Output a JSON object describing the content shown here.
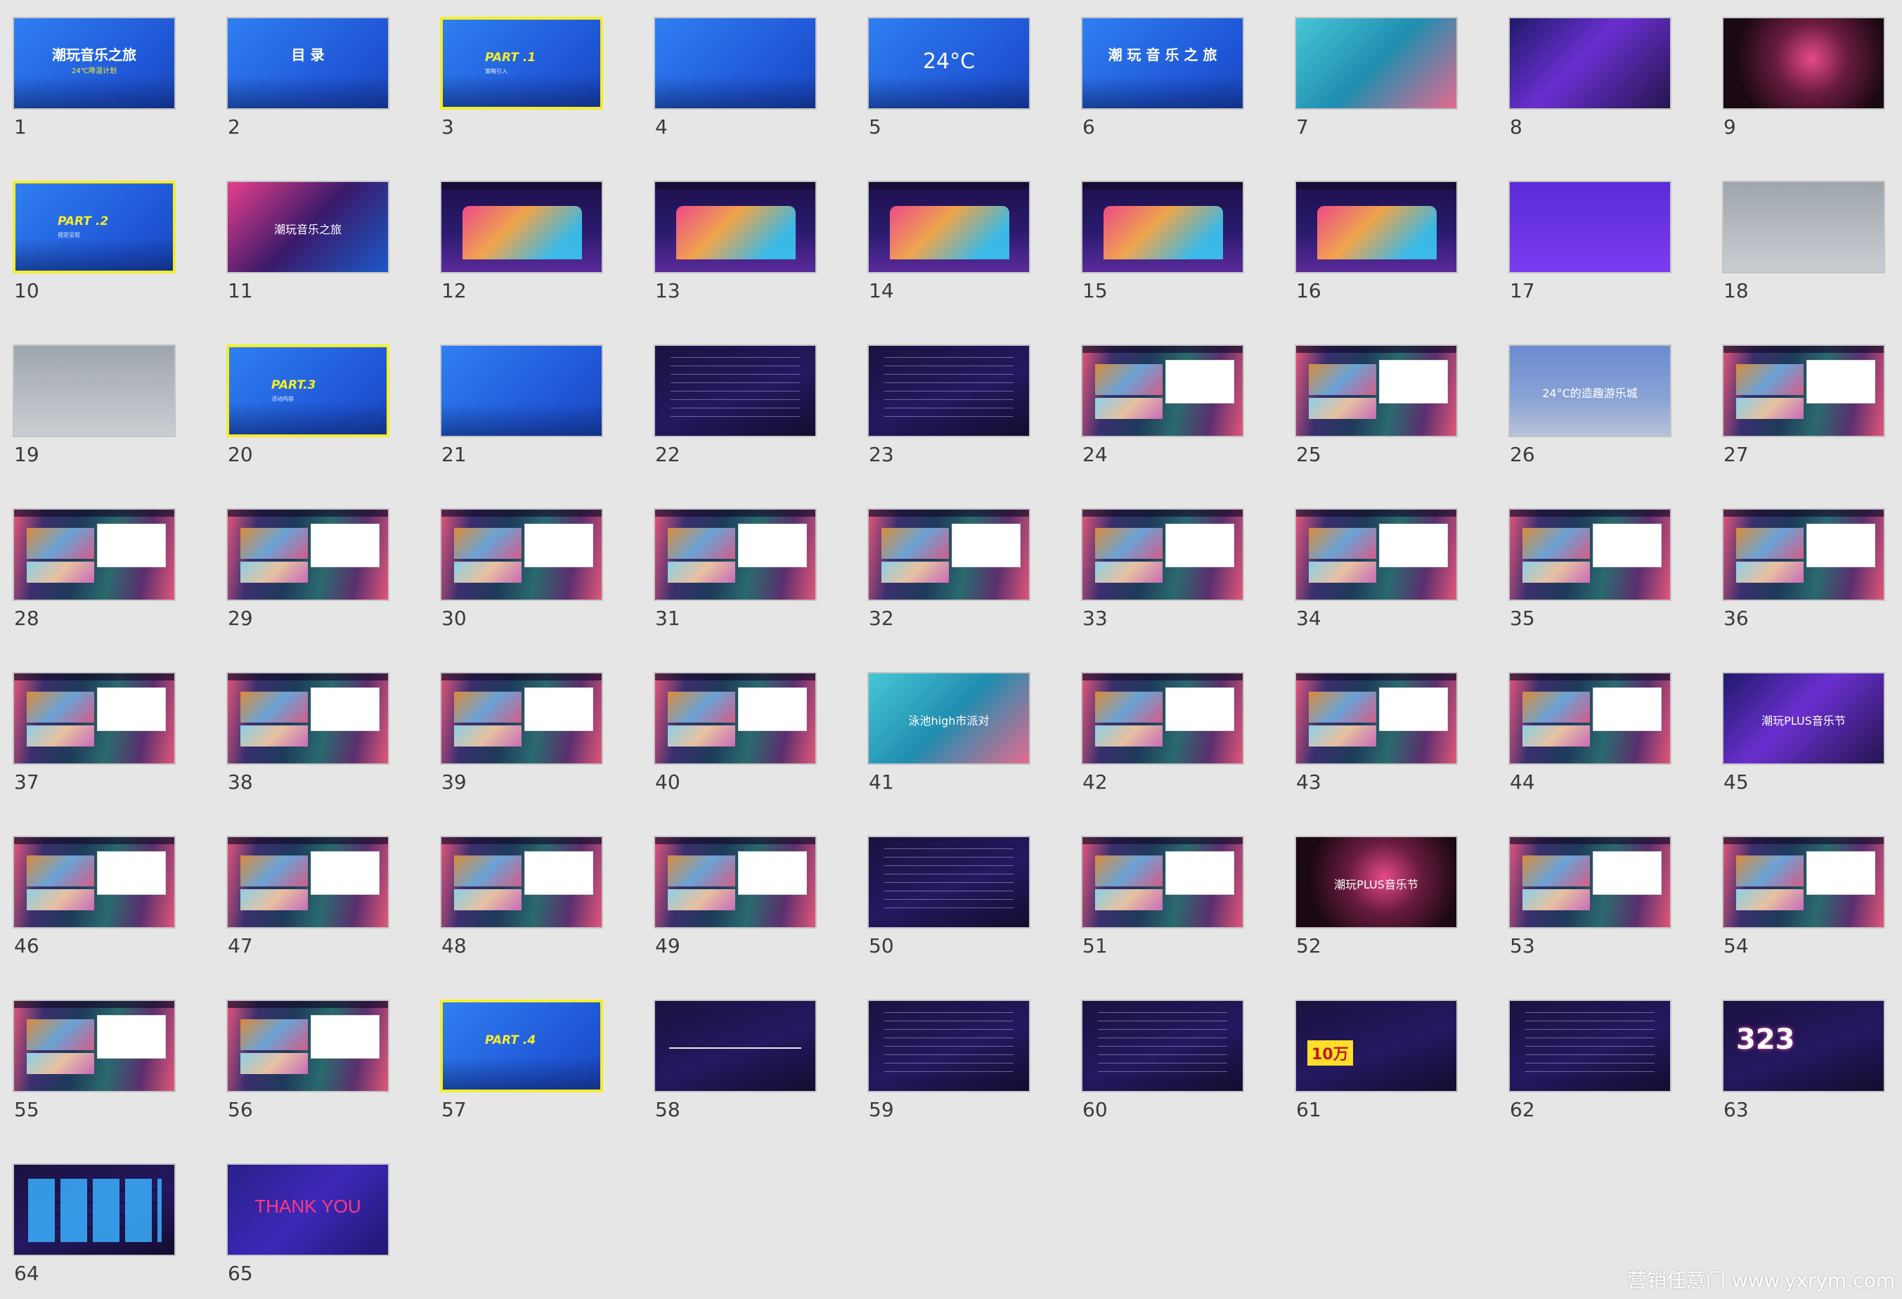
{
  "slides": [
    {
      "number": "1",
      "theme": "blue",
      "title": "潮玩音乐之旅",
      "subtitle": "24℃降温计划"
    },
    {
      "number": "2",
      "theme": "blue",
      "title": "目 录"
    },
    {
      "number": "3",
      "theme": "blueY",
      "title": "PART .1",
      "subtitle": "策略引入"
    },
    {
      "number": "4",
      "theme": "blue"
    },
    {
      "number": "5",
      "theme": "blue",
      "title": "24°C"
    },
    {
      "number": "6",
      "theme": "blue",
      "title": "潮 玩 音 乐 之 旅"
    },
    {
      "number": "7",
      "theme": "pool"
    },
    {
      "number": "8",
      "theme": "night"
    },
    {
      "number": "9",
      "theme": "fire"
    },
    {
      "number": "10",
      "theme": "blueY",
      "title": "PART .2",
      "subtitle": "视觉呈现"
    },
    {
      "number": "11",
      "theme": "neon",
      "title": "潮玩音乐之旅"
    },
    {
      "number": "12",
      "theme": "stage"
    },
    {
      "number": "13",
      "theme": "stage"
    },
    {
      "number": "14",
      "theme": "stage"
    },
    {
      "number": "15",
      "theme": "stage"
    },
    {
      "number": "16",
      "theme": "stage"
    },
    {
      "number": "17",
      "theme": "purple"
    },
    {
      "number": "18",
      "theme": "gray"
    },
    {
      "number": "19",
      "theme": "gray"
    },
    {
      "number": "20",
      "theme": "blueY",
      "title": "PART.3",
      "subtitle": "活动内容"
    },
    {
      "number": "21",
      "theme": "blue"
    },
    {
      "number": "22",
      "theme": "dark"
    },
    {
      "number": "23",
      "theme": "dark"
    },
    {
      "number": "24",
      "theme": "city"
    },
    {
      "number": "25",
      "theme": "city"
    },
    {
      "number": "26",
      "theme": "sky",
      "title": "24°C的造趣游乐城"
    },
    {
      "number": "27",
      "theme": "city"
    },
    {
      "number": "28",
      "theme": "city"
    },
    {
      "number": "29",
      "theme": "city"
    },
    {
      "number": "30",
      "theme": "city"
    },
    {
      "number": "31",
      "theme": "city"
    },
    {
      "number": "32",
      "theme": "city"
    },
    {
      "number": "33",
      "theme": "city"
    },
    {
      "number": "34",
      "theme": "city"
    },
    {
      "number": "35",
      "theme": "city"
    },
    {
      "number": "36",
      "theme": "city"
    },
    {
      "number": "37",
      "theme": "city"
    },
    {
      "number": "38",
      "theme": "city"
    },
    {
      "number": "39",
      "theme": "city"
    },
    {
      "number": "40",
      "theme": "city"
    },
    {
      "number": "41",
      "theme": "pool",
      "title": "泳池high市派对"
    },
    {
      "number": "42",
      "theme": "city"
    },
    {
      "number": "43",
      "theme": "city"
    },
    {
      "number": "44",
      "theme": "city"
    },
    {
      "number": "45",
      "theme": "night",
      "title": "潮玩PLUS音乐节"
    },
    {
      "number": "46",
      "theme": "city"
    },
    {
      "number": "47",
      "theme": "city"
    },
    {
      "number": "48",
      "theme": "city"
    },
    {
      "number": "49",
      "theme": "city"
    },
    {
      "number": "50",
      "theme": "dark"
    },
    {
      "number": "51",
      "theme": "city"
    },
    {
      "number": "52",
      "theme": "fire",
      "title": "潮玩PLUS音乐节"
    },
    {
      "number": "53",
      "theme": "city"
    },
    {
      "number": "54",
      "theme": "city"
    },
    {
      "number": "55",
      "theme": "city"
    },
    {
      "number": "56",
      "theme": "city"
    },
    {
      "number": "57",
      "theme": "blueY",
      "title": "PART .4"
    },
    {
      "number": "58",
      "theme": "dark"
    },
    {
      "number": "59",
      "theme": "dark"
    },
    {
      "number": "60",
      "theme": "dark"
    },
    {
      "number": "61",
      "theme": "dark",
      "title": "10万"
    },
    {
      "number": "62",
      "theme": "dark"
    },
    {
      "number": "63",
      "theme": "dark",
      "title": "323"
    },
    {
      "number": "64",
      "theme": "dark"
    },
    {
      "number": "65",
      "theme": "thanks",
      "title": "THANK YOU"
    }
  ],
  "watermark": "营销任意门 www.yxrym.com"
}
